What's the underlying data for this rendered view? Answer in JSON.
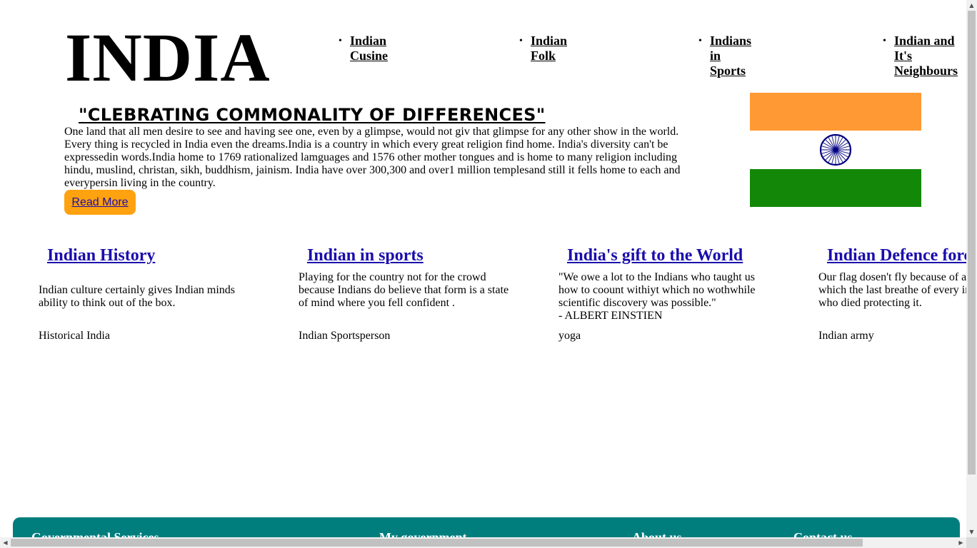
{
  "header": {
    "logo_text": "INDIA",
    "nav": [
      {
        "label": "Indian Cusine"
      },
      {
        "label": "Indian Folk"
      },
      {
        "label": "Indians in Sports"
      },
      {
        "label": "Indian and It's Neighbours"
      }
    ]
  },
  "hero": {
    "tagline": "\"CLEBRATING COMMONALITY OF DIFFERENCES\"",
    "intro": "One land that all men desire to see and having see one, even by a glimpse, would not giv that glimpse for any other show in the world. Every thing is recycled in India even the dreams.India is a country in which every great religion find home. India's diversity can't be expressedin words.India home to 1769 rationalized lamguages and 1576 other mother tongues and is home to many religion including hindu, muslind, christan, sikh, buddhism, jainism. India have over 300,300 and over1 million templesand still it fells home to each and everypersin living in the country.",
    "read_more_label": "Read More",
    "flag_colors": {
      "saffron": "#ff9933",
      "white": "#ffffff",
      "green": "#138808",
      "chakra": "#000080"
    }
  },
  "cards": [
    {
      "title": "Indian History",
      "text": "Indian culture certainly gives Indian minds ability to think out of the box.",
      "image_alt": "Historical India"
    },
    {
      "title": "Indian in sports",
      "text": "Playing for the country not for the crowd because Indians do believe that form is a state of mind where you fell confident .",
      "image_alt": "Indian Sportsperson"
    },
    {
      "title": "India's gift to the World",
      "text": "\"We owe a lot to the Indians who taught us how to coount withiyt which no wothwhile scientific discovery was possible.\"",
      "quote_author": "- ALBERT EINSTIEN",
      "image_alt": "yoga"
    },
    {
      "title": "Indian Defence forces",
      "text": "Our flag dosen't fly because of air which the last breathe of every indian who died protecting it.",
      "image_alt": "Indian army"
    }
  ],
  "footer": {
    "links": [
      {
        "label": "Governmental Services"
      },
      {
        "label": "My government"
      },
      {
        "label": "About us"
      },
      {
        "label": "Contact us"
      }
    ],
    "bg_color": "#007e7e"
  },
  "colors": {
    "link": "#1a0dab",
    "button": "#ffa20f"
  }
}
